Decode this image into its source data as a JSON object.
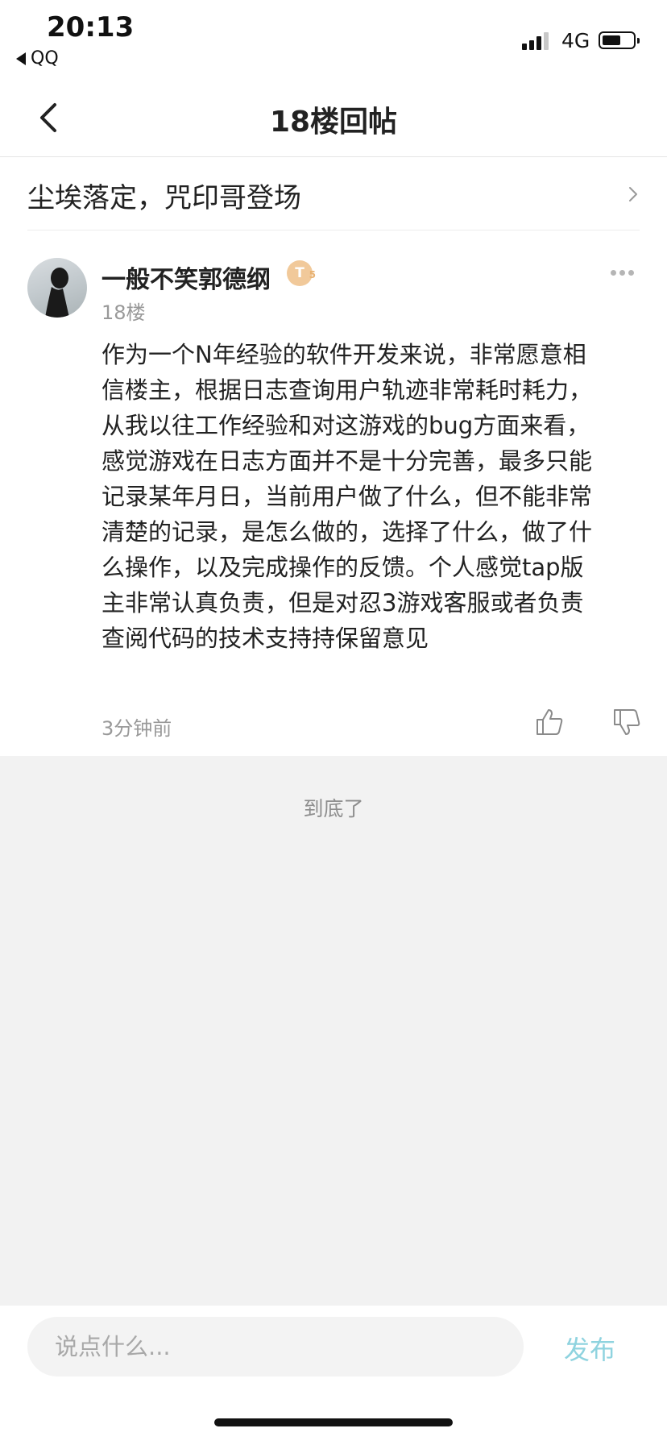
{
  "status_bar": {
    "time": "20:13",
    "back_app": "QQ",
    "network": "4G",
    "battery_level": 0.6,
    "icons": [
      "signal-icon",
      "battery-icon"
    ]
  },
  "nav": {
    "title": "18楼回帖",
    "back_icon": "chevron-left-icon"
  },
  "topic": {
    "title": "尘埃落定，咒印哥登场",
    "chevron_icon": "chevron-right-icon"
  },
  "post": {
    "username": "一般不笑郭德纲",
    "level_badge": "T",
    "level_badge_sub": "5",
    "floor": "18楼",
    "content_lines": [
      "作为一个N年经验的软件开发来说，非常愿意相",
      "信楼主，根据日志查询用户轨迹非常耗时耗力，",
      "从我以往工作经验和对这游戏的bug方面来看，",
      "感觉游戏在日志方面并不是十分完善，最多只能",
      "记录某年月日，当前用户做了什么，但不能非常",
      "清楚的记录，是怎么做的，选择了什么，做了什",
      "么操作，以及完成操作的反馈。个人感觉tap版",
      "主非常认真负责，但是对忍3游戏客服或者负责",
      "查阅代码的技术支持持保留意见"
    ],
    "time": "3分钟前",
    "icons": [
      "avatar",
      "more-icon",
      "thumbs-up-icon",
      "thumbs-down-icon"
    ]
  },
  "end_text": "到底了",
  "comment_bar": {
    "placeholder": "说点什么...",
    "publish_label": "发布"
  },
  "colors": {
    "background": "#f2f2f2",
    "publish_accent": "#8fd3df",
    "badge": "#f1c99a"
  }
}
